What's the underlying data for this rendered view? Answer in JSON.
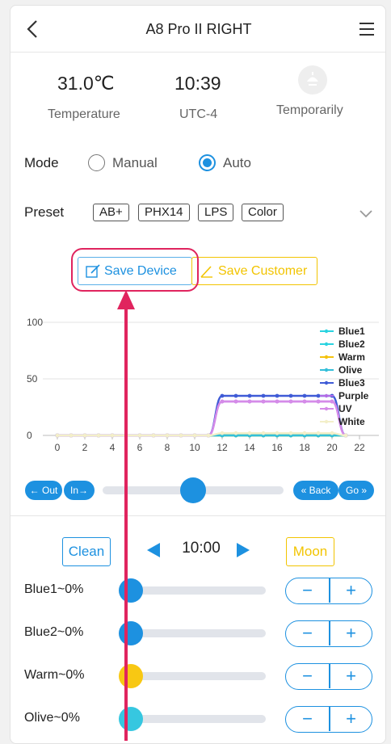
{
  "header": {
    "title": "A8 Pro II RIGHT"
  },
  "stats": {
    "temperature_value": "31.0℃",
    "temperature_label": "Temperature",
    "time_value": "10:39",
    "time_label": "UTC-4",
    "status_label": "Temporarily"
  },
  "mode": {
    "label": "Mode",
    "options": [
      "Manual",
      "Auto"
    ],
    "selected": "Auto"
  },
  "preset": {
    "label": "Preset",
    "chips": [
      "AB+",
      "PHX14",
      "LPS",
      "Color"
    ]
  },
  "buttons": {
    "save_device": "Save Device",
    "save_customer": "Save Customer"
  },
  "chart_data": {
    "type": "line",
    "title": "",
    "xlabel": "",
    "ylabel": "",
    "xlim": [
      -0.5,
      23
    ],
    "ylim": [
      0,
      100
    ],
    "x_ticks": [
      0,
      2,
      4,
      6,
      8,
      10,
      12,
      14,
      16,
      18,
      20,
      22
    ],
    "y_ticks": [
      0,
      50,
      100
    ],
    "legend_position": "right",
    "series": [
      {
        "name": "Blue1",
        "color": "#2ad3e0",
        "x": [
          0,
          1,
          2,
          3,
          4,
          5,
          6,
          7,
          8,
          9,
          10,
          11,
          12,
          13,
          14,
          15,
          16,
          17,
          18,
          19,
          20,
          21
        ],
        "y": [
          0,
          0,
          0,
          0,
          0,
          0,
          0,
          0,
          0,
          0,
          0,
          0,
          0,
          0,
          0,
          0,
          0,
          0,
          0,
          0,
          0,
          0
        ]
      },
      {
        "name": "Blue2",
        "color": "#2ad3e0",
        "x": [
          0,
          1,
          2,
          3,
          4,
          5,
          6,
          7,
          8,
          9,
          10,
          11,
          12,
          13,
          14,
          15,
          16,
          17,
          18,
          19,
          20,
          21
        ],
        "y": [
          0,
          0,
          0,
          0,
          0,
          0,
          0,
          0,
          0,
          0,
          0,
          0,
          0,
          0,
          0,
          0,
          0,
          0,
          0,
          0,
          0,
          0
        ]
      },
      {
        "name": "Warm",
        "color": "#f4c20d",
        "x": [
          0,
          1,
          2,
          3,
          4,
          5,
          6,
          7,
          8,
          9,
          10,
          11,
          12,
          13,
          14,
          15,
          16,
          17,
          18,
          19,
          20,
          21
        ],
        "y": [
          0,
          0,
          0,
          0,
          0,
          0,
          0,
          0,
          0,
          0,
          0,
          0,
          0,
          0,
          0,
          0,
          0,
          0,
          0,
          0,
          0,
          0
        ]
      },
      {
        "name": "Olive",
        "color": "#33bfd9",
        "x": [
          0,
          1,
          2,
          3,
          4,
          5,
          6,
          7,
          8,
          9,
          10,
          11,
          12,
          13,
          14,
          15,
          16,
          17,
          18,
          19,
          20,
          21
        ],
        "y": [
          0,
          0,
          0,
          0,
          0,
          0,
          0,
          0,
          0,
          0,
          0,
          0,
          0,
          0,
          0,
          0,
          0,
          0,
          0,
          0,
          0,
          0
        ]
      },
      {
        "name": "Blue3",
        "color": "#3f5bd6",
        "x": [
          0,
          1,
          2,
          3,
          4,
          5,
          6,
          7,
          8,
          9,
          10,
          11,
          12,
          13,
          14,
          15,
          16,
          17,
          18,
          19,
          20,
          21
        ],
        "y": [
          0,
          0,
          0,
          0,
          0,
          0,
          0,
          0,
          0,
          0,
          0,
          0,
          35,
          35,
          35,
          35,
          35,
          35,
          35,
          35,
          35,
          0
        ]
      },
      {
        "name": "Purple",
        "color": "#b26be6",
        "x": [
          0,
          1,
          2,
          3,
          4,
          5,
          6,
          7,
          8,
          9,
          10,
          11,
          12,
          13,
          14,
          15,
          16,
          17,
          18,
          19,
          20,
          21
        ],
        "y": [
          0,
          0,
          0,
          0,
          0,
          0,
          0,
          0,
          0,
          0,
          0,
          0,
          30,
          30,
          30,
          30,
          30,
          30,
          30,
          30,
          30,
          0
        ]
      },
      {
        "name": "UV",
        "color": "#d58be8",
        "x": [
          0,
          1,
          2,
          3,
          4,
          5,
          6,
          7,
          8,
          9,
          10,
          11,
          12,
          13,
          14,
          15,
          16,
          17,
          18,
          19,
          20,
          21
        ],
        "y": [
          0,
          0,
          0,
          0,
          0,
          0,
          0,
          0,
          0,
          0,
          0,
          0,
          30,
          30,
          30,
          30,
          30,
          30,
          30,
          30,
          30,
          0
        ]
      },
      {
        "name": "White",
        "color": "#f3efc9",
        "x": [
          0,
          1,
          2,
          3,
          4,
          5,
          6,
          7,
          8,
          9,
          10,
          11,
          12,
          13,
          14,
          15,
          16,
          17,
          18,
          19,
          20,
          21
        ],
        "y": [
          0,
          0,
          0,
          0,
          0,
          0,
          0,
          0,
          0,
          0,
          0,
          0,
          2,
          2,
          2,
          2,
          2,
          2,
          2,
          2,
          2,
          0
        ]
      }
    ]
  },
  "transport": {
    "out": "← Out",
    "in": "In→",
    "back": "« Back",
    "go": "Go »",
    "slider_position": 0.5
  },
  "time_control": {
    "clean": "Clean",
    "time": "10:00",
    "moon": "Moon"
  },
  "channels": [
    {
      "label": "Blue1~0%",
      "color": "#1d91e0",
      "value": 0
    },
    {
      "label": "Blue2~0%",
      "color": "#1d91e0",
      "value": 0
    },
    {
      "label": "Warm~0%",
      "color": "#f8c813",
      "value": 0
    },
    {
      "label": "Olive~0%",
      "color": "#36c7e0",
      "value": 0
    }
  ],
  "stepper": {
    "minus": "−",
    "plus": "+"
  },
  "annotation": {
    "color": "#e0245e"
  }
}
